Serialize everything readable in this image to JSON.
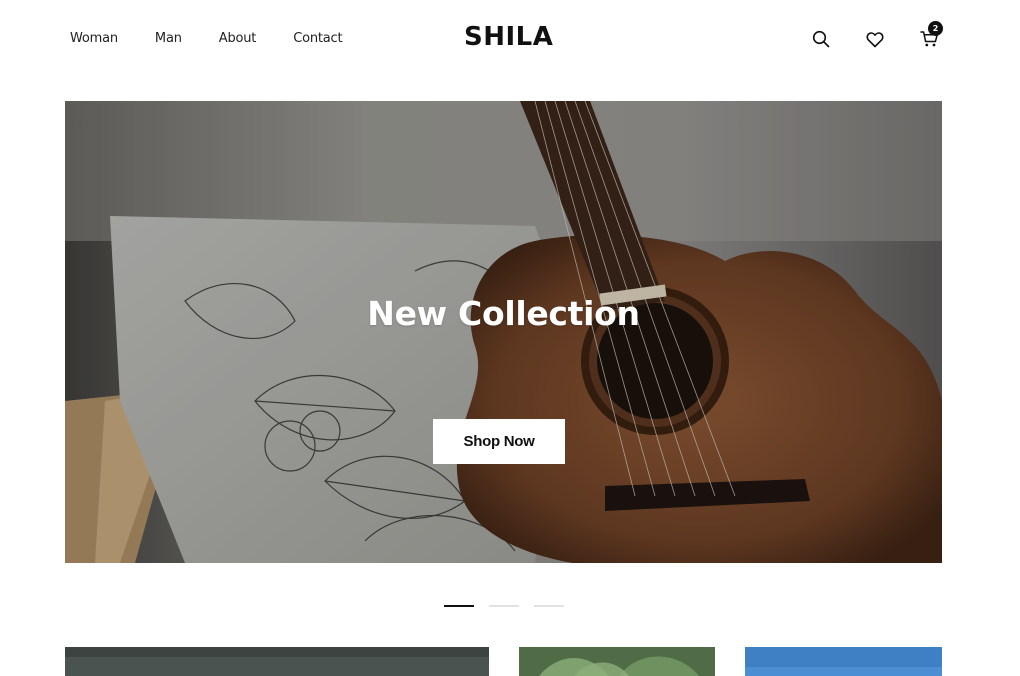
{
  "header": {
    "nav": [
      {
        "label": "Woman"
      },
      {
        "label": "Man"
      },
      {
        "label": "About"
      },
      {
        "label": "Contact"
      }
    ],
    "logo": "SHILA",
    "icons": {
      "search": "search-icon",
      "wishlist": "heart-icon",
      "cart": "cart-icon"
    },
    "cart_count": "2"
  },
  "hero": {
    "title": "New Collection",
    "cta_label": "Shop Now",
    "image": "guitar-and-leaf-pillow"
  },
  "slider": {
    "slides": 3,
    "active_index": 0
  },
  "teasers": [
    {
      "image": "dark-landscape"
    },
    {
      "image": "green-leaves"
    },
    {
      "image": "blue-sky"
    }
  ],
  "colors": {
    "text": "#111111",
    "background": "#ffffff",
    "dot_inactive": "#e2e2e2",
    "dot_active": "#111111"
  }
}
